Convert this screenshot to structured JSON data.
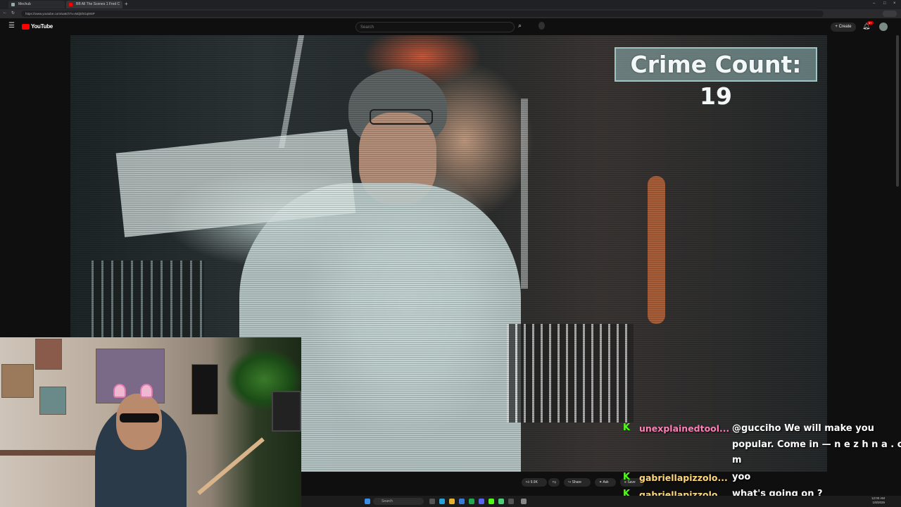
{
  "browser": {
    "tabs": [
      {
        "label": "Mechub"
      },
      {
        "label": "BB All The Scenes 1 Fred C"
      }
    ],
    "new_tab": "+",
    "url": "https://www.youtube.com/watch?v=MdjShGq9r6P",
    "window_controls": [
      "–",
      "□",
      "×"
    ]
  },
  "youtube": {
    "logo_text": "YouTube",
    "search_placeholder": "Search",
    "create_label": "Create",
    "notification_count": "9+"
  },
  "video": {
    "overlay_text": "Crime Count: 19"
  },
  "actions": {
    "likes": "9.9K",
    "share": "Share",
    "ask": "Ask",
    "save": "Save"
  },
  "chat": [
    {
      "platform_icon": "K",
      "username": "unexplainedtool...",
      "username_color": "#ff7fb7",
      "message_lines": [
        "@gucciho We will make you",
        "popular. Come in — n e z h n a . c o",
        "m"
      ]
    },
    {
      "platform_icon": "K",
      "username": "gabriellapizzolo...",
      "username_color": "#ffd77a",
      "message_lines": [
        "yoo"
      ]
    },
    {
      "platform_icon": "K",
      "username": "gabriellapizzolo...",
      "username_color": "#ffd77a",
      "message_lines": [
        "what's going on ?"
      ]
    }
  ],
  "taskbar": {
    "search_label": "Search",
    "time": "12:00 AM",
    "date": "1/8/2026"
  },
  "colors": {
    "kick_green": "#53fc18",
    "youtube_red": "#ff0000",
    "overlay_border": "#9fc4c4"
  }
}
